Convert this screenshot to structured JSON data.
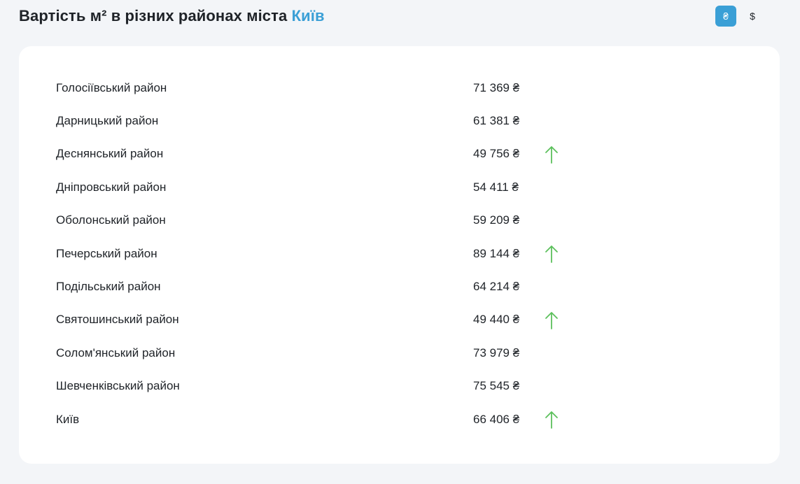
{
  "header": {
    "title_prefix": "Вартість м² в різних районах міста ",
    "title_city": "Київ"
  },
  "currency": {
    "options": [
      {
        "symbol": "₴",
        "active": true
      },
      {
        "symbol": "$",
        "active": false
      }
    ]
  },
  "colors": {
    "accent": "#3a9fd6",
    "trend_up": "#5cc05c",
    "card_bg": "#ffffff",
    "page_bg": "#f3f5f8"
  },
  "districts": [
    {
      "name": "Голосіївський район",
      "price": "71 369 ₴",
      "trend": "none"
    },
    {
      "name": "Дарницький район",
      "price": "61 381 ₴",
      "trend": "none"
    },
    {
      "name": "Деснянський район",
      "price": "49 756 ₴",
      "trend": "up"
    },
    {
      "name": "Дніпровський район",
      "price": "54 411 ₴",
      "trend": "none"
    },
    {
      "name": "Оболонський район",
      "price": "59 209 ₴",
      "trend": "none"
    },
    {
      "name": "Печерський район",
      "price": "89 144 ₴",
      "trend": "up"
    },
    {
      "name": "Подільський район",
      "price": "64 214 ₴",
      "trend": "none"
    },
    {
      "name": "Святошинський район",
      "price": "49 440 ₴",
      "trend": "up"
    },
    {
      "name": "Солом'янський район",
      "price": "73 979 ₴",
      "trend": "none"
    },
    {
      "name": "Шевченківський район",
      "price": "75 545 ₴",
      "trend": "none"
    },
    {
      "name": "Київ",
      "price": "66 406 ₴",
      "trend": "up"
    }
  ]
}
